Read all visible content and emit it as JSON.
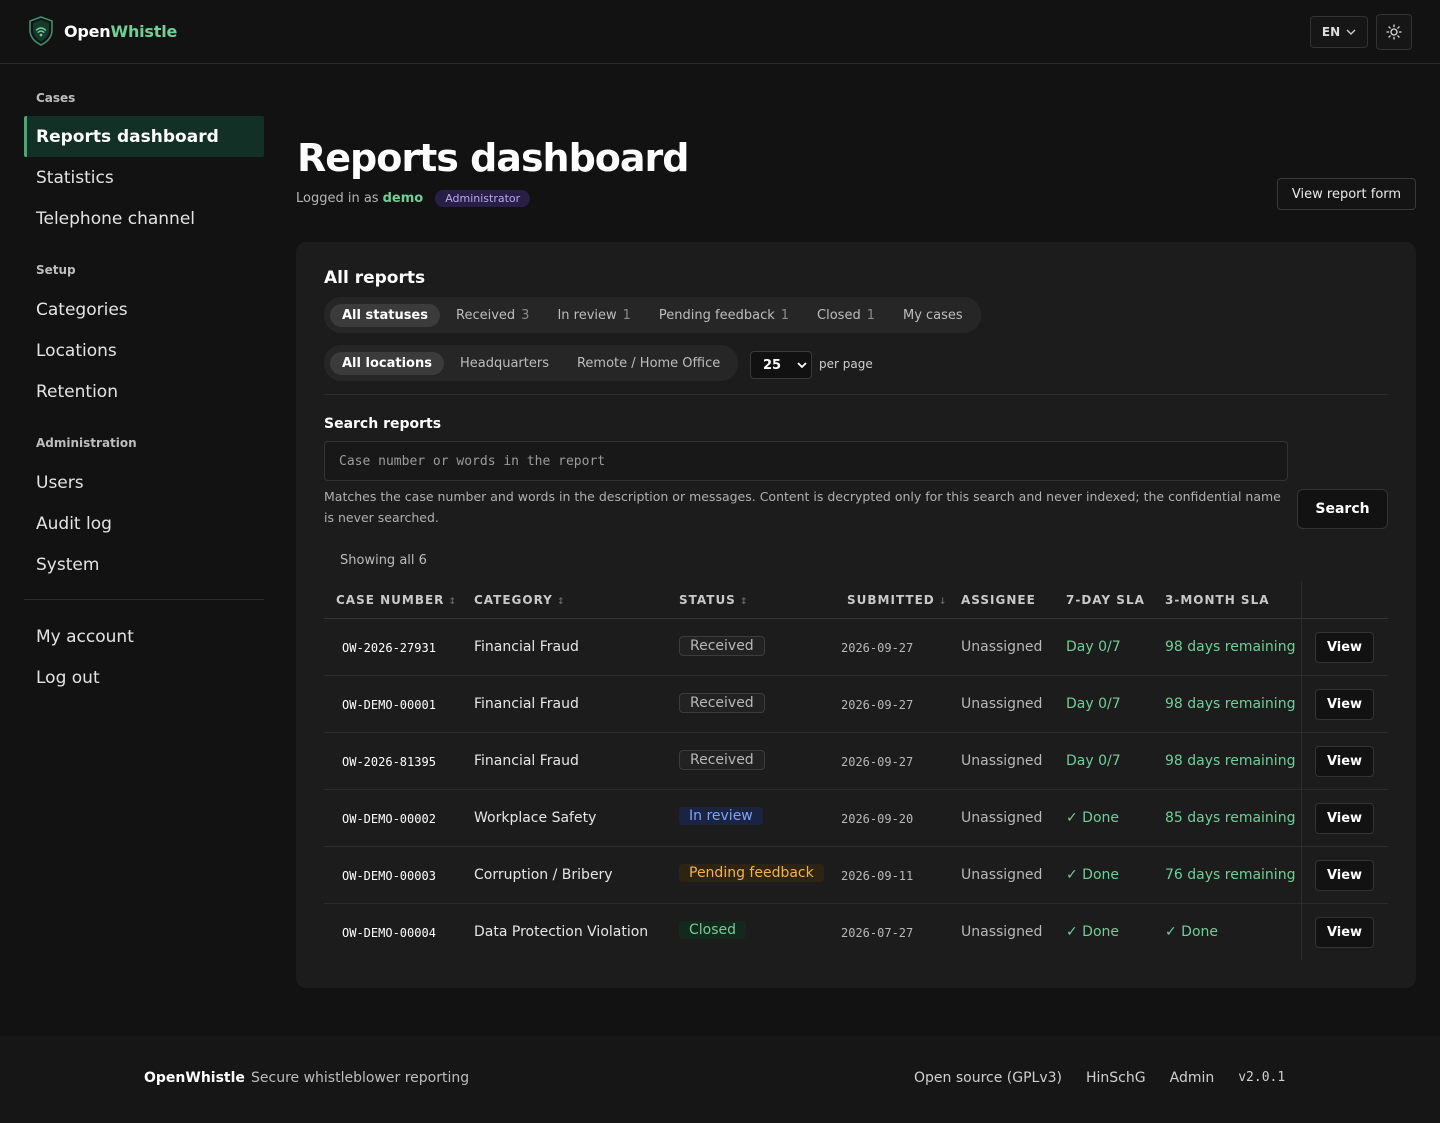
{
  "app": {
    "brand_primary": "Open",
    "brand_accent": "Whistle",
    "accent_color": "#6fcf97"
  },
  "header": {
    "language": "EN"
  },
  "sidebar": {
    "sections": [
      {
        "title": "Cases",
        "items": [
          {
            "label": "Reports dashboard",
            "active": true
          },
          {
            "label": "Statistics"
          },
          {
            "label": "Telephone channel"
          }
        ]
      },
      {
        "title": "Setup",
        "items": [
          {
            "label": "Categories"
          },
          {
            "label": "Locations"
          },
          {
            "label": "Retention"
          }
        ]
      },
      {
        "title": "Administration",
        "items": [
          {
            "label": "Users"
          },
          {
            "label": "Audit log"
          },
          {
            "label": "System"
          }
        ]
      }
    ],
    "bottom_items": [
      {
        "label": "My account"
      },
      {
        "label": "Log out"
      }
    ]
  },
  "page": {
    "title": "Reports dashboard",
    "logged_in_prefix": "Logged in as",
    "username": "demo",
    "role": "Administrator",
    "view_form_label": "View report form"
  },
  "reports": {
    "title": "All reports",
    "status_filters": [
      {
        "label": "All statuses",
        "count": "",
        "active": true
      },
      {
        "label": "Received",
        "count": "3"
      },
      {
        "label": "In review",
        "count": "1"
      },
      {
        "label": "Pending feedback",
        "count": "1"
      },
      {
        "label": "Closed",
        "count": "1"
      },
      {
        "label": "My cases",
        "count": ""
      }
    ],
    "location_filters": [
      {
        "label": "All locations",
        "active": true
      },
      {
        "label": "Headquarters"
      },
      {
        "label": "Remote / Home Office"
      }
    ],
    "per_page_value": "25",
    "per_page_label": "per page",
    "search_label": "Search reports",
    "search_placeholder": "Case number or words in the report",
    "search_help": "Matches the case number and words in the description or messages. Content is decrypted only for this search and never indexed; the confidential name is never searched.",
    "search_button": "Search",
    "showing": "Showing all 6",
    "columns": [
      "CASE NUMBER",
      "CATEGORY",
      "STATUS",
      "SUBMITTED",
      "ASSIGNEE",
      "7-DAY SLA",
      "3-MONTH SLA"
    ],
    "rows": [
      {
        "case": "OW-2026-27931",
        "category": "Financial Fraud",
        "status": "Received",
        "status_kind": "received",
        "submitted": "2026-09-27",
        "assignee": "Unassigned",
        "sla7": "Day 0/7",
        "sla3": "98 days remaining",
        "action": "View"
      },
      {
        "case": "OW-DEMO-00001",
        "category": "Financial Fraud",
        "status": "Received",
        "status_kind": "received",
        "submitted": "2026-09-27",
        "assignee": "Unassigned",
        "sla7": "Day 0/7",
        "sla3": "98 days remaining",
        "action": "View"
      },
      {
        "case": "OW-2026-81395",
        "category": "Financial Fraud",
        "status": "Received",
        "status_kind": "received",
        "submitted": "2026-09-27",
        "assignee": "Unassigned",
        "sla7": "Day 0/7",
        "sla3": "98 days remaining",
        "action": "View"
      },
      {
        "case": "OW-DEMO-00002",
        "category": "Workplace Safety",
        "status": "In review",
        "status_kind": "in-review",
        "submitted": "2026-09-20",
        "assignee": "Unassigned",
        "sla7": "✓ Done",
        "sla3": "85 days remaining",
        "action": "View"
      },
      {
        "case": "OW-DEMO-00003",
        "category": "Corruption / Bribery",
        "status": "Pending feedback",
        "status_kind": "pending",
        "submitted": "2026-09-11",
        "assignee": "Unassigned",
        "sla7": "✓ Done",
        "sla3": "76 days remaining",
        "action": "View"
      },
      {
        "case": "OW-DEMO-00004",
        "category": "Data Protection Violation",
        "status": "Closed",
        "status_kind": "closed",
        "submitted": "2026-07-27",
        "assignee": "Unassigned",
        "sla7": "✓ Done",
        "sla3": "✓ Done",
        "action": "View"
      }
    ]
  },
  "footer": {
    "brand": "OpenWhistle",
    "tagline": "Secure whistleblower reporting",
    "links": [
      "Open source (GPLv3)",
      "HinSchG",
      "Admin"
    ],
    "version": "v2.0.1"
  }
}
